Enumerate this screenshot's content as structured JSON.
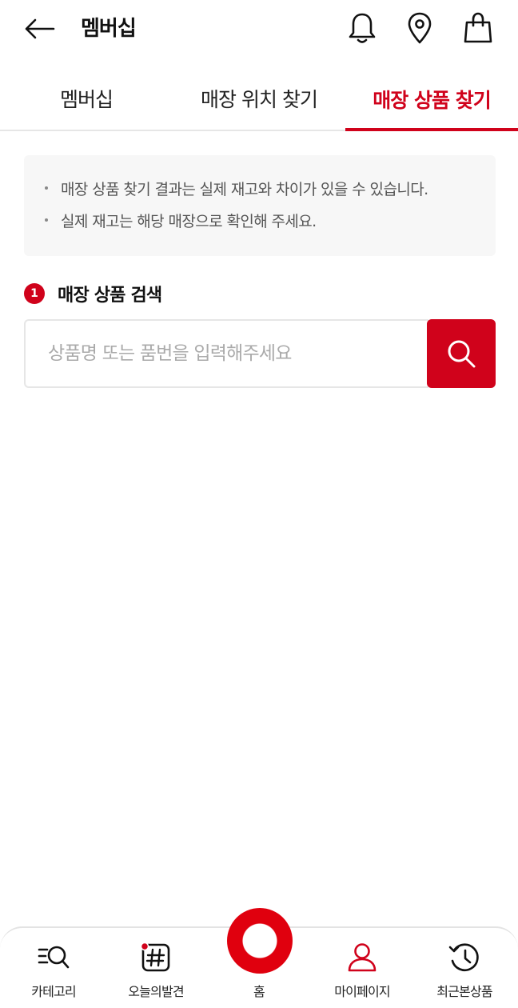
{
  "header": {
    "title": "멤버십",
    "icons": [
      "back-arrow-icon",
      "bell-icon",
      "location-pin-icon",
      "shopping-bag-icon"
    ]
  },
  "tabs": [
    {
      "label": "멤버십",
      "active": false
    },
    {
      "label": "매장 위치 찾기",
      "active": false
    },
    {
      "label": "매장 상품 찾기",
      "active": true
    }
  ],
  "notice": {
    "lines": [
      "매장 상품 찾기 결과는 실제 재고와 차이가 있을 수 있습니다.",
      "실제 재고는 해당 매장으로 확인해 주세요."
    ]
  },
  "search_section": {
    "step": "1",
    "title": "매장 상품 검색",
    "placeholder": "상품명 또는 품번을 입력해주세요",
    "value": ""
  },
  "bottom_nav": {
    "items": [
      {
        "label": "카테고리",
        "icon": "category-search-icon"
      },
      {
        "label": "오늘의발견",
        "icon": "hashtag-icon"
      },
      {
        "label": "홈",
        "icon": "home-ring-icon"
      },
      {
        "label": "마이페이지",
        "icon": "user-icon"
      },
      {
        "label": "최근본상품",
        "icon": "history-icon"
      }
    ]
  },
  "colors": {
    "accent": "#d0021b",
    "home_ring": "#e0000e",
    "notice_bg": "#f7f7f7",
    "border": "#e6e6e6"
  }
}
